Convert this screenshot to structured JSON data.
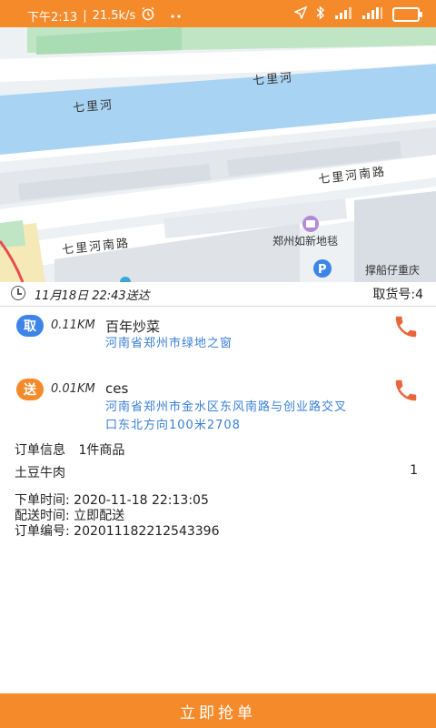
{
  "status_bar": {
    "time": "下午2:13",
    "speed": "21.5k/s",
    "icons": [
      "alarm-icon",
      "more-dots-icon",
      "location-arrow-icon",
      "bluetooth-icon",
      "signal-icon",
      "signal-icon",
      "battery-icon"
    ]
  },
  "map": {
    "river_label_1": "七里河",
    "river_label_2": "七里河",
    "road_label_1": "七里河南路",
    "road_label_2": "七里河南路",
    "poi_name": "郑州如新地毯",
    "poi_right": "撑船仔重庆"
  },
  "order_header": {
    "time_text": "11月18日 22:43送达",
    "pickup_code": "取货号:4"
  },
  "pickup": {
    "badge": "取",
    "distance": "0.11KM",
    "name": "百年炒菜",
    "address": "河南省郑州市绿地之窗"
  },
  "delivery": {
    "badge": "送",
    "distance": "0.01KM",
    "name": "ces",
    "address_line1": "河南省郑州市金水区东风南路与创业路交叉",
    "address_line2": "口东北方向100米2708"
  },
  "order_info": {
    "label": "订单信息",
    "summary": "1件商品",
    "item_name": "土豆牛肉",
    "item_qty": "1",
    "order_time": "下单时间: 2020-11-18 22:13:05",
    "delivery_time": "配送时间: 立即配送",
    "order_number": "订单编号: 20201118221254339​6"
  },
  "colors": {
    "accent": "#f58a2b",
    "pickup_badge": "#3d86e8",
    "address_link": "#3a7fd6",
    "phone_icon": "#e8673a"
  },
  "actions": {
    "grab_label": "立即抢单"
  }
}
